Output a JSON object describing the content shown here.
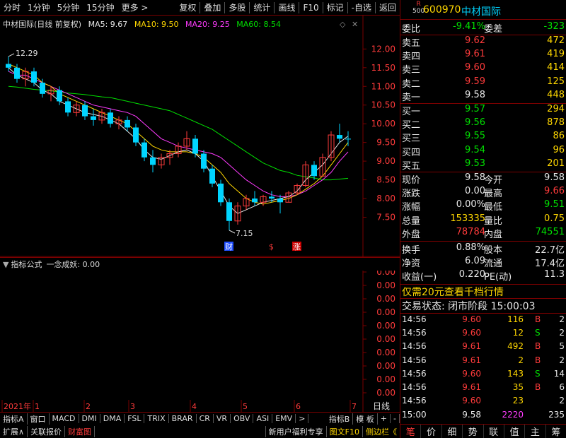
{
  "toolbar": {
    "left": [
      "分时",
      "1分钟",
      "5分钟",
      "15分钟",
      "更多 >"
    ],
    "right": [
      "复权",
      "叠加",
      "多股",
      "统计",
      "画线",
      "F10",
      "标记",
      "-自选",
      "返回"
    ]
  },
  "chart_title": {
    "name": "中材国际(日线 前复权)",
    "ma5": "MA5: 9.67",
    "ma10": "MA10: 9.50",
    "ma20": "MA20: 9.25",
    "ma60": "MA60: 8.54"
  },
  "colors": {
    "ma5": "#e8e8e8",
    "ma10": "#ffd700",
    "ma20": "#ff3bff",
    "ma60": "#00e000",
    "up": "#ff3b3b",
    "down": "#00d4ff"
  },
  "price_axis": [
    "12.00",
    "11.50",
    "11.00",
    "10.50",
    "10.00",
    "9.50",
    "9.00",
    "8.50",
    "8.00",
    "7.50"
  ],
  "high_label": "12.29",
  "low_label": "7.15",
  "markers": [
    "财",
    "$",
    "涨"
  ],
  "indicator": {
    "title": "指标公式",
    "name": "一念成妖: 0.00",
    "axis": [
      "0.00",
      "0.00",
      "0.00",
      "0.00",
      "0.00",
      "0.00",
      "0.00",
      "0.00",
      "0.00",
      "0.00"
    ]
  },
  "x_axis": [
    "2021年",
    "1",
    "2",
    "3",
    "4",
    "5",
    "6",
    "7"
  ],
  "x_axis_right": "日线",
  "chart_data": {
    "type": "candlestick",
    "ylim": [
      7.15,
      12.29
    ],
    "candles": [
      [
        11.6,
        11.8,
        11.4,
        11.5
      ],
      [
        11.5,
        11.6,
        11.1,
        11.2
      ],
      [
        11.2,
        11.5,
        11.0,
        11.4
      ],
      [
        11.4,
        11.5,
        11.0,
        11.1
      ],
      [
        11.1,
        11.2,
        10.7,
        10.8
      ],
      [
        10.8,
        11.0,
        10.6,
        10.9
      ],
      [
        10.9,
        11.0,
        10.5,
        10.6
      ],
      [
        10.6,
        10.7,
        10.2,
        10.3
      ],
      [
        10.3,
        10.6,
        10.2,
        10.5
      ],
      [
        10.5,
        10.6,
        10.1,
        10.2
      ],
      [
        10.2,
        10.4,
        9.95,
        10.1
      ],
      [
        10.1,
        10.4,
        10.0,
        10.3
      ],
      [
        10.3,
        10.4,
        9.9,
        10.0
      ],
      [
        10.0,
        10.2,
        9.85,
        10.1
      ],
      [
        10.1,
        10.2,
        9.8,
        9.9
      ],
      [
        9.9,
        10.0,
        9.4,
        9.5
      ],
      [
        9.5,
        9.6,
        9.0,
        9.1
      ],
      [
        9.1,
        9.3,
        8.7,
        8.9
      ],
      [
        8.9,
        9.2,
        8.8,
        9.1
      ],
      [
        9.1,
        9.3,
        8.9,
        9.2
      ],
      [
        9.2,
        9.5,
        9.1,
        9.4
      ],
      [
        9.4,
        9.8,
        9.3,
        9.6
      ],
      [
        9.6,
        9.7,
        9.1,
        9.2
      ],
      [
        9.2,
        9.3,
        8.7,
        8.8
      ],
      [
        8.8,
        8.9,
        8.3,
        8.4
      ],
      [
        8.4,
        8.5,
        7.8,
        7.9
      ],
      [
        7.9,
        8.0,
        7.15,
        7.4
      ],
      [
        7.4,
        7.9,
        7.3,
        7.8
      ],
      [
        7.8,
        8.1,
        7.7,
        8.0
      ],
      [
        8.0,
        8.2,
        7.8,
        7.9
      ],
      [
        7.9,
        8.1,
        7.8,
        8.05
      ],
      [
        8.05,
        8.2,
        7.9,
        8.0
      ],
      [
        8.0,
        8.1,
        7.6,
        7.9
      ],
      [
        7.9,
        8.2,
        7.9,
        8.15
      ],
      [
        8.15,
        8.4,
        8.1,
        8.35
      ],
      [
        8.35,
        9.0,
        8.3,
        8.9
      ],
      [
        8.9,
        9.0,
        8.5,
        8.6
      ],
      [
        8.6,
        9.2,
        8.6,
        9.1
      ],
      [
        9.1,
        9.8,
        9.0,
        9.7
      ],
      [
        9.7,
        10.0,
        9.5,
        9.6
      ],
      [
        9.6,
        9.8,
        9.4,
        9.58
      ]
    ],
    "ma5": [
      11.5,
      11.3,
      11.2,
      11.1,
      10.9,
      10.8,
      10.6,
      10.5,
      10.4,
      10.3,
      10.25,
      10.2,
      10.1,
      10.0,
      9.8,
      9.6,
      9.3,
      9.1,
      9.05,
      9.15,
      9.25,
      9.3,
      9.2,
      9.0,
      8.6,
      8.2,
      7.8,
      7.6,
      7.7,
      7.8,
      7.9,
      7.95,
      8.0,
      8.05,
      8.2,
      8.5,
      8.7,
      8.9,
      9.2,
      9.5,
      9.67
    ],
    "ma10": [
      11.6,
      11.5,
      11.4,
      11.3,
      11.1,
      11.0,
      10.8,
      10.7,
      10.6,
      10.5,
      10.4,
      10.3,
      10.2,
      10.1,
      10.0,
      9.8,
      9.6,
      9.4,
      9.3,
      9.25,
      9.25,
      9.25,
      9.2,
      9.1,
      8.9,
      8.7,
      8.4,
      8.2,
      8.0,
      7.9,
      7.85,
      7.9,
      7.95,
      8.0,
      8.1,
      8.25,
      8.4,
      8.6,
      8.9,
      9.2,
      9.5
    ],
    "ma20": [
      11.4,
      11.3,
      11.3,
      11.2,
      11.1,
      11.0,
      10.9,
      10.8,
      10.7,
      10.6,
      10.5,
      10.45,
      10.4,
      10.35,
      10.3,
      10.2,
      10.0,
      9.8,
      9.6,
      9.5,
      9.4,
      9.35,
      9.3,
      9.25,
      9.2,
      9.1,
      8.9,
      8.7,
      8.5,
      8.35,
      8.2,
      8.1,
      8.05,
      8.05,
      8.1,
      8.2,
      8.35,
      8.5,
      8.7,
      9.0,
      9.25
    ],
    "ma60": [
      11.0,
      10.98,
      10.95,
      10.92,
      10.9,
      10.88,
      10.85,
      10.82,
      10.8,
      10.78,
      10.75,
      10.72,
      10.7,
      10.65,
      10.6,
      10.55,
      10.5,
      10.45,
      10.4,
      10.35,
      10.25,
      10.15,
      10.05,
      9.95,
      9.85,
      9.7,
      9.55,
      9.4,
      9.25,
      9.1,
      8.95,
      8.85,
      8.75,
      8.7,
      8.62,
      8.58,
      8.55,
      8.5,
      8.5,
      8.52,
      8.54
    ]
  },
  "bottom_tabs": [
    "指标A",
    "窗口",
    "MACD",
    "DMI",
    "DMA",
    "FSL",
    "TRIX",
    "BRAR",
    "CR",
    "VR",
    "OBV",
    "ASI",
    "EMV",
    ">",
    "指标B",
    "模 板",
    "+",
    "-"
  ],
  "status_bar": {
    "left": [
      "扩展∧",
      "关联报价",
      "财富图"
    ],
    "right": [
      "新用户福利专享",
      "图文F10",
      "侧边栏《"
    ]
  },
  "quote": {
    "code": "600970",
    "name": "中材国际",
    "r_label": "R",
    "r_sub": "500",
    "wb_label": "委比",
    "wb_value": "-9.41%",
    "wc_label": "委差",
    "wc_value": "-323",
    "asks": [
      {
        "label": "卖五",
        "price": "9.62",
        "vol": "472"
      },
      {
        "label": "卖四",
        "price": "9.61",
        "vol": "419"
      },
      {
        "label": "卖三",
        "price": "9.60",
        "vol": "414"
      },
      {
        "label": "卖二",
        "price": "9.59",
        "vol": "125"
      },
      {
        "label": "卖一",
        "price": "9.58",
        "vol": "448"
      }
    ],
    "bids": [
      {
        "label": "买一",
        "price": "9.57",
        "vol": "294"
      },
      {
        "label": "买二",
        "price": "9.56",
        "vol": "878"
      },
      {
        "label": "买三",
        "price": "9.55",
        "vol": "86"
      },
      {
        "label": "买四",
        "price": "9.54",
        "vol": "96"
      },
      {
        "label": "买五",
        "price": "9.53",
        "vol": "201"
      }
    ],
    "stats": [
      {
        "l1": "现价",
        "v1": "9.58",
        "l2": "今开",
        "v2": "9.58",
        "c1": "white",
        "c2": "white"
      },
      {
        "l1": "涨跌",
        "v1": "0.00",
        "l2": "最高",
        "v2": "9.66",
        "c1": "white",
        "c2": "red"
      },
      {
        "l1": "涨幅",
        "v1": "0.00%",
        "l2": "最低",
        "v2": "9.51",
        "c1": "white",
        "c2": "green"
      },
      {
        "l1": "总量",
        "v1": "153335",
        "l2": "量比",
        "v2": "0.75",
        "c1": "yellow",
        "c2": "yellow"
      },
      {
        "l1": "外盘",
        "v1": "78784",
        "l2": "内盘",
        "v2": "74551",
        "c1": "red",
        "c2": "green"
      }
    ],
    "fund": [
      {
        "l1": "换手",
        "v1": "0.88%",
        "l2": "股本",
        "v2": "22.7亿"
      },
      {
        "l1": "净资",
        "v1": "6.09",
        "l2": "流通",
        "v2": "17.4亿"
      },
      {
        "l1": "收益(一)",
        "v1": "0.220",
        "l2": "PE(动)",
        "v2": "11.3"
      }
    ],
    "promo": "仅需20元查看千档行情",
    "trade_status": "交易状态: 闭市阶段 15:00:03",
    "ticks": [
      {
        "t": "14:56",
        "p": "9.60",
        "q": "116",
        "bs": "B",
        "n": "2",
        "c": "red"
      },
      {
        "t": "14:56",
        "p": "9.60",
        "q": "12",
        "bs": "S",
        "n": "2",
        "c": "green"
      },
      {
        "t": "14:56",
        "p": "9.61",
        "q": "492",
        "bs": "B",
        "n": "5",
        "c": "red"
      },
      {
        "t": "14:56",
        "p": "9.61",
        "q": "2",
        "bs": "B",
        "n": "2",
        "c": "red"
      },
      {
        "t": "14:56",
        "p": "9.60",
        "q": "143",
        "bs": "S",
        "n": "14",
        "c": "green"
      },
      {
        "t": "14:56",
        "p": "9.61",
        "q": "35",
        "bs": "B",
        "n": "6",
        "c": "red"
      },
      {
        "t": "14:56",
        "p": "9.60",
        "q": "23",
        "bs": "",
        "n": "2",
        "c": ""
      },
      {
        "t": "15:00",
        "p": "9.58",
        "q": "2220",
        "bs": "",
        "n": "235",
        "c": ""
      }
    ],
    "tabs": [
      "笔",
      "价",
      "细",
      "势",
      "联",
      "值",
      "主",
      "筹"
    ]
  }
}
